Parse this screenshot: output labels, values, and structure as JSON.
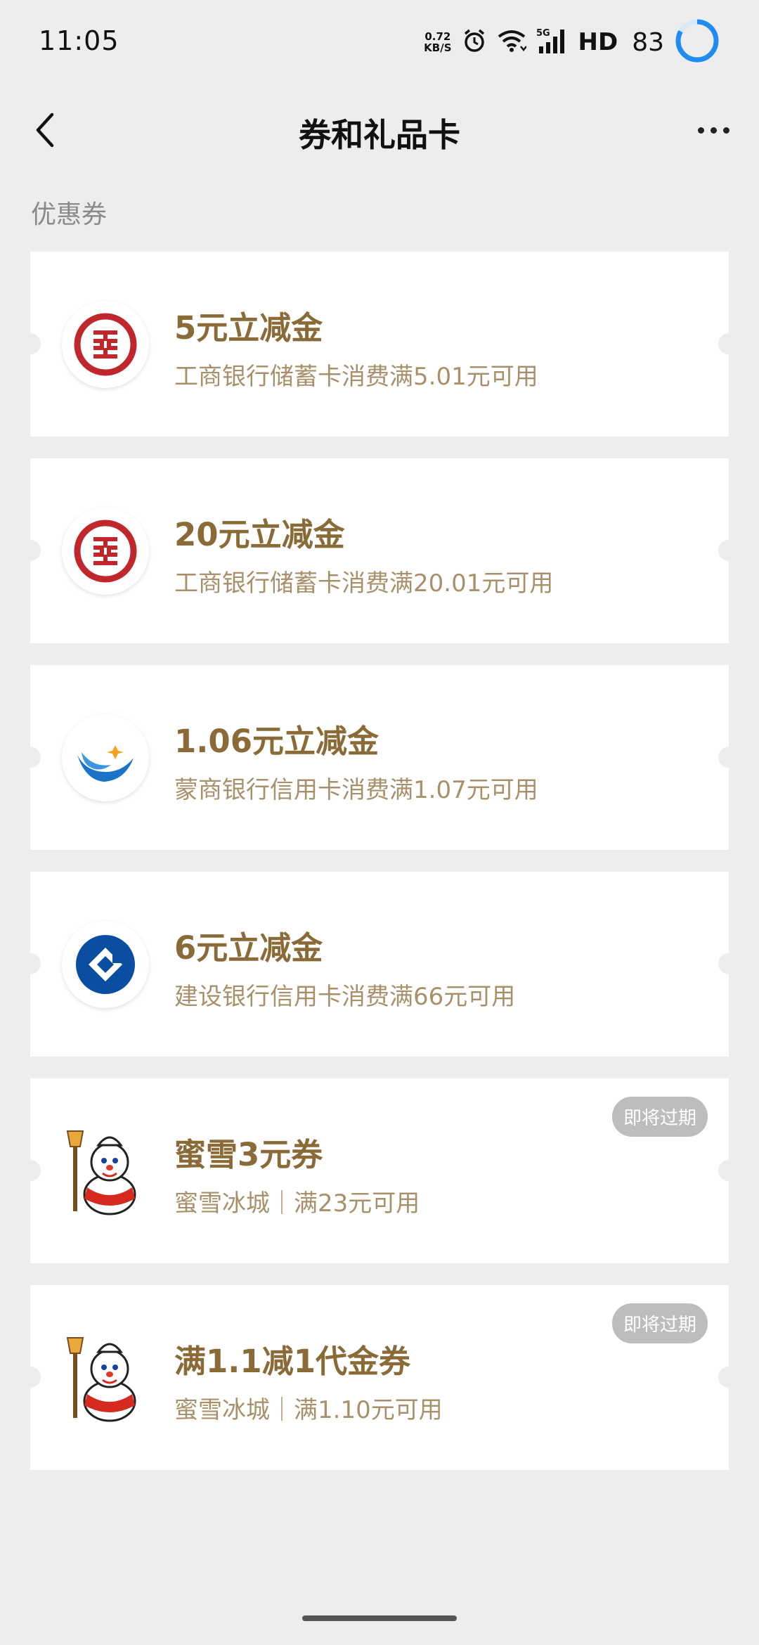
{
  "status": {
    "time": "11:05",
    "net_speed_value": "0.72",
    "net_speed_unit": "KB/S",
    "network": "5G",
    "hd": "HD",
    "battery": "83"
  },
  "nav": {
    "title": "券和礼品卡"
  },
  "section_label": "优惠券",
  "coupons": [
    {
      "title": "5元立减金",
      "subtitle": "工商银行储蓄卡消费满5.01元可用",
      "logo": "icbc-logo",
      "badge": ""
    },
    {
      "title": "20元立减金",
      "subtitle": "工商银行储蓄卡消费满20.01元可用",
      "logo": "icbc-logo",
      "badge": ""
    },
    {
      "title": "1.06元立减金",
      "subtitle": "蒙商银行信用卡消费满1.07元可用",
      "logo": "mengshang-bank-logo",
      "badge": ""
    },
    {
      "title": "6元立减金",
      "subtitle": "建设银行信用卡消费满66元可用",
      "logo": "ccb-logo",
      "badge": ""
    },
    {
      "title": "蜜雪3元券",
      "subtitle": "蜜雪冰城｜满23元可用",
      "logo": "mixue-snowman-logo",
      "badge": "即将过期"
    },
    {
      "title": "满1.1减1代金券",
      "subtitle": "蜜雪冰城｜满1.10元可用",
      "logo": "mixue-snowman-logo",
      "badge": "即将过期"
    }
  ],
  "colors": {
    "background": "#ededed",
    "title_gold": "#8a6a37",
    "subtitle_gold": "#a8916a",
    "icbc_red": "#c0272d",
    "ccb_blue": "#0a4ea2",
    "badge_gray": "#bdbdbd",
    "battery_ring": "#1e8cf0"
  }
}
